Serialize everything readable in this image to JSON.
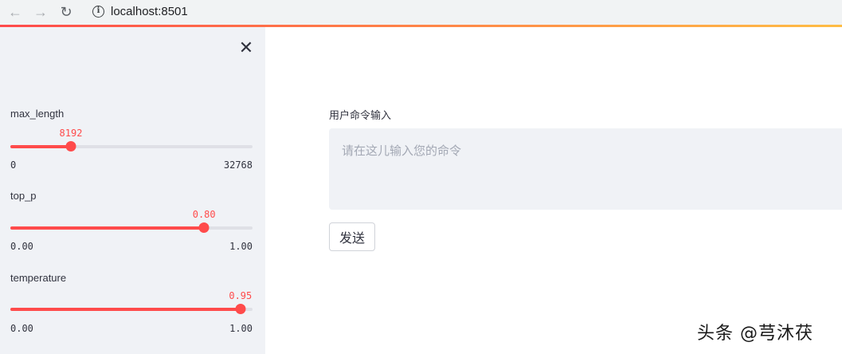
{
  "browser": {
    "back_icon": "←",
    "forward_icon": "→",
    "reload_icon": "↻",
    "info_icon": "i",
    "url": "localhost:8501"
  },
  "sidebar": {
    "close_icon": "✕",
    "sliders": [
      {
        "label": "max_length",
        "value": "8192",
        "min": "0",
        "max": "32768",
        "fraction": 0.25
      },
      {
        "label": "top_p",
        "value": "0.80",
        "min": "0.00",
        "max": "1.00",
        "fraction": 0.8
      },
      {
        "label": "temperature",
        "value": "0.95",
        "min": "0.00",
        "max": "1.00",
        "fraction": 0.95
      }
    ]
  },
  "main": {
    "input_label": "用户命令输入",
    "input_placeholder": "请在这儿输入您的命令",
    "input_value": "",
    "send_label": "发送"
  },
  "watermark": "头条 @芎沐茯",
  "colors": {
    "accent": "#ff4b4b",
    "sidebar_bg": "#f0f2f6"
  }
}
